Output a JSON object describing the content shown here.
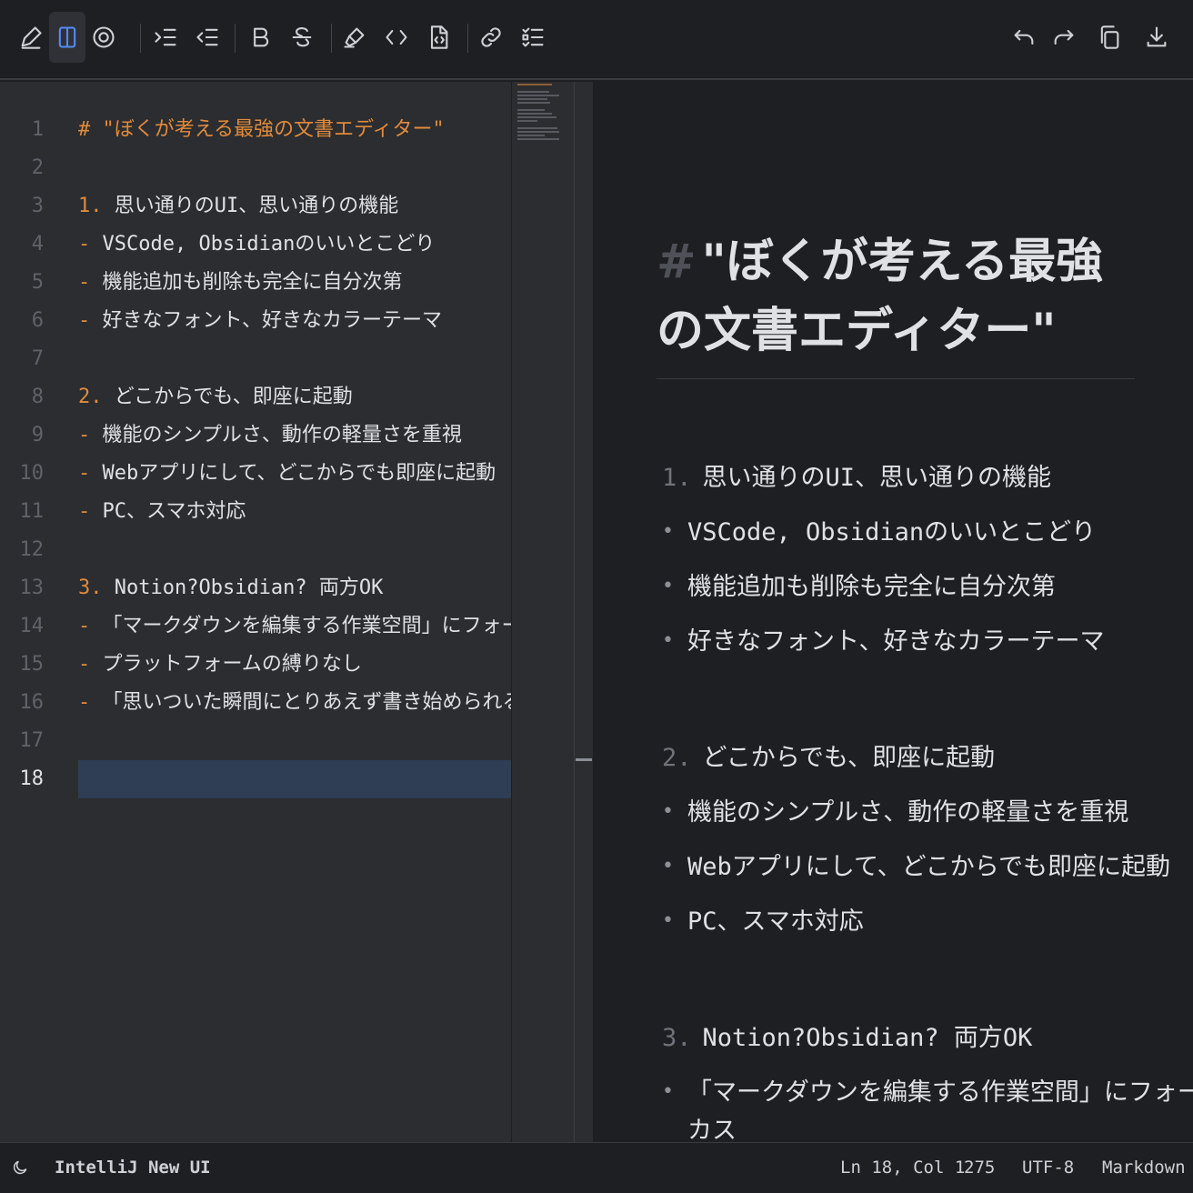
{
  "toolbar": {
    "buttons": [
      {
        "name": "edit-mode",
        "icon": "pencil-icon"
      },
      {
        "name": "split-view",
        "icon": "split-columns-icon",
        "active": true
      },
      {
        "name": "preview-mode",
        "icon": "eye-target-icon"
      },
      {
        "name": "indent",
        "icon": "indent-icon"
      },
      {
        "name": "outdent",
        "icon": "outdent-icon"
      },
      {
        "name": "bold",
        "icon": "bold-icon"
      },
      {
        "name": "strikethrough",
        "icon": "strikethrough-icon"
      },
      {
        "name": "highlight",
        "icon": "highlighter-icon"
      },
      {
        "name": "inline-code",
        "icon": "code-brackets-icon"
      },
      {
        "name": "code-file",
        "icon": "code-file-icon"
      },
      {
        "name": "link",
        "icon": "link-icon"
      },
      {
        "name": "checklist",
        "icon": "checklist-icon"
      },
      {
        "name": "undo",
        "icon": "undo-icon"
      },
      {
        "name": "redo",
        "icon": "redo-icon"
      },
      {
        "name": "copy",
        "icon": "copy-icon"
      },
      {
        "name": "download",
        "icon": "download-icon"
      }
    ]
  },
  "editor": {
    "current_line": 18,
    "lines": [
      {
        "n": "1",
        "marker": "#",
        "text": " \"ぼくが考える最強の文書エディター\"",
        "type": "heading"
      },
      {
        "n": "2",
        "marker": "",
        "text": "",
        "type": "blank"
      },
      {
        "n": "3",
        "marker": "1.",
        "text": " 思い通りのUI、思い通りの機能",
        "type": "ordered"
      },
      {
        "n": "4",
        "marker": "-",
        "text": " VSCode, Obsidianのいいとこどり",
        "type": "bullet"
      },
      {
        "n": "5",
        "marker": "-",
        "text": " 機能追加も削除も完全に自分次第",
        "type": "bullet"
      },
      {
        "n": "6",
        "marker": "-",
        "text": " 好きなフォント、好きなカラーテーマ",
        "type": "bullet"
      },
      {
        "n": "7",
        "marker": "",
        "text": "",
        "type": "blank"
      },
      {
        "n": "8",
        "marker": "2.",
        "text": " どこからでも、即座に起動",
        "type": "ordered"
      },
      {
        "n": "9",
        "marker": "-",
        "text": " 機能のシンプルさ、動作の軽量さを重視",
        "type": "bullet"
      },
      {
        "n": "10",
        "marker": "-",
        "text": " Webアプリにして、どこからでも即座に起動",
        "type": "bullet"
      },
      {
        "n": "11",
        "marker": "-",
        "text": " PC、スマホ対応",
        "type": "bullet"
      },
      {
        "n": "12",
        "marker": "",
        "text": "",
        "type": "blank"
      },
      {
        "n": "13",
        "marker": "3.",
        "text": " Notion?Obsidian? 両方OK",
        "type": "ordered"
      },
      {
        "n": "14",
        "marker": "-",
        "text": " 「マークダウンを編集する作業空間」にフォーカス",
        "type": "bullet"
      },
      {
        "n": "15",
        "marker": "-",
        "text": " プラットフォームの縛りなし",
        "type": "bullet"
      },
      {
        "n": "16",
        "marker": "-",
        "text": " 「思いついた瞬間にとりあえず書き始められる」を",
        "type": "bullet"
      },
      {
        "n": "17",
        "marker": "",
        "text": "",
        "type": "blank"
      },
      {
        "n": "18",
        "marker": "",
        "text": "",
        "type": "blank"
      }
    ]
  },
  "preview": {
    "title_hash": "#",
    "title": "\"ぼくが考える最強の文書エディター\"",
    "sections": [
      {
        "num": "1.",
        "heading": "思い通りのUI、思い通りの機能",
        "bullets": [
          "VSCode, Obsidianのいいとこどり",
          "機能追加も削除も完全に自分次第",
          "好きなフォント、好きなカラーテーマ"
        ]
      },
      {
        "num": "2.",
        "heading": "どこからでも、即座に起動",
        "bullets": [
          "機能のシンプルさ、動作の軽量さを重視",
          "Webアプリにして、どこからでも即座に起動",
          "PC、スマホ対応"
        ]
      },
      {
        "num": "3.",
        "heading": "Notion?Obsidian? 両方OK",
        "bullets": [
          "「マークダウンを編集する作業空間」にフォー",
          "カス"
        ]
      }
    ]
  },
  "statusbar": {
    "theme_icon": "moon-icon",
    "theme_name": "IntelliJ New UI",
    "cursor": "Ln 18, Col 1",
    "char_count": "275",
    "encoding": "UTF-8",
    "language": "Markdown"
  },
  "colors": {
    "accent": "#548af7",
    "markdown_marker": "#e08a3c",
    "editor_bg": "#2b2d30",
    "preview_bg": "#1e1f22",
    "current_line": "#2f3d55"
  }
}
